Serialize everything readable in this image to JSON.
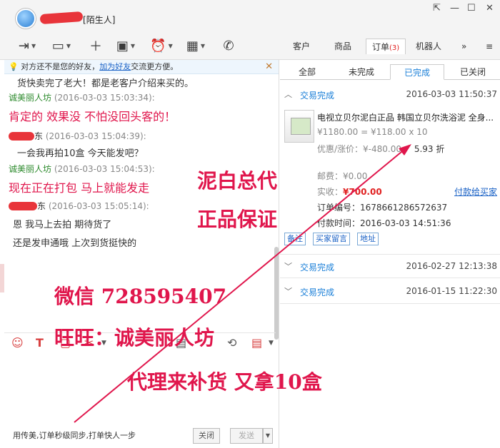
{
  "window": {
    "title_suffix": "陌生人"
  },
  "toolbar": {
    "tabs": [
      {
        "label": "客户"
      },
      {
        "label": "商品"
      },
      {
        "label": "订单",
        "badge": "(3)"
      },
      {
        "label": "机器人"
      },
      {
        "label": "»"
      }
    ]
  },
  "notice": {
    "text": "对方还不是您的好友，",
    "link": "加为好友",
    "tail": "交流更方便。"
  },
  "chat": [
    {
      "text": "货快卖完了老大！都是老客户介绍来买的。"
    },
    {
      "sender": "诚美丽人坊",
      "time": "(2016-03-03 15:03:34):"
    },
    {
      "text": "肯定的 效果没 不怕没回头客的！"
    },
    {
      "sender": "东",
      "time": "(2016-03-03 15:04:39):"
    },
    {
      "text": "一会我再拍10盒 今天能发吧？"
    },
    {
      "sender": "诚美丽人坊",
      "time": "(2016-03-03 15:04:53):"
    },
    {
      "text": "现在正在打包 马上就能发走"
    },
    {
      "sender": "东",
      "time": "(2016-03-03 15:05:14):"
    },
    {
      "text": "恩 我马上去拍 期待货了"
    },
    {
      "text": "还是发申通哦 上次到货挺快的"
    }
  ],
  "overlays": {
    "line1": "泥白总代",
    "line2": "正品保证",
    "wechat": "微信 728595407",
    "wangwang": "旺旺：诚美丽人坊",
    "restock": "代理来补货 又拿10盒"
  },
  "bottom": {
    "hint": "用传美,订单秒级同步,打单快人一步",
    "close": "关闭",
    "send": "发送"
  },
  "orders": {
    "subtabs": [
      "全部",
      "未完成",
      "已完成",
      "已关闭"
    ],
    "rows": [
      {
        "status": "交易完成",
        "datetime": "2016-03-03 11:50:37"
      },
      {
        "status": "交易完成",
        "datetime": "2016-02-27 12:13:38"
      },
      {
        "status": "交易完成",
        "datetime": "2016-01-15 11:22:30"
      }
    ],
    "product": {
      "name": "电视立贝尔泥白正品 韩国立贝尔洗浴泥 全身...",
      "price_line": "¥1180.00 = ¥118.00 x 10",
      "discount": "优惠/涨价：¥-480.00",
      "discount_rate": "5.93 折",
      "shipping": "邮费：¥0.00",
      "paid_label": "实收：",
      "paid_value": "¥700.00",
      "pay_link": "付款给买家",
      "order_no": "订单编号：1678661286572637",
      "pay_time": "付款时间：2016-03-03 14:51:36",
      "tags": [
        "备注",
        "买家留言",
        "地址"
      ]
    }
  }
}
